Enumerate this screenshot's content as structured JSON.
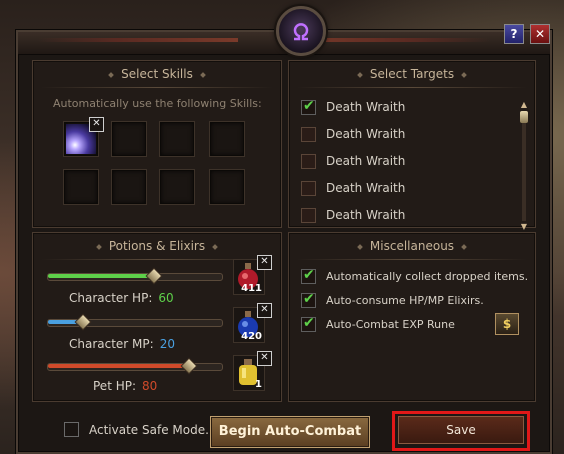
{
  "colors": {
    "check": "#5ed04a",
    "accent_red": "#e01818",
    "hp_green": "#5ed04a",
    "mp_blue": "#4aa0e0",
    "pet_red": "#d04a2a"
  },
  "titlebar": {
    "help_label": "?",
    "close_label": "✕",
    "emblem_icon": "omega-emblem-icon"
  },
  "skills": {
    "title": "Select Skills",
    "subtitle": "Automatically use the following Skills:",
    "remove_label": "✕"
  },
  "targets": {
    "title": "Select Targets",
    "items": [
      {
        "label": "Death Wraith",
        "checked": true
      },
      {
        "label": "Death Wraith",
        "checked": false
      },
      {
        "label": "Death Wraith",
        "checked": false
      },
      {
        "label": "Death Wraith",
        "checked": false
      },
      {
        "label": "Death Wraith",
        "checked": false
      }
    ]
  },
  "potions": {
    "title": "Potions & Elixirs",
    "character_hp": {
      "label": "Character HP:",
      "value": "60",
      "level": 0.6
    },
    "character_mp": {
      "label": "Character MP:",
      "value": "20",
      "level": 0.2
    },
    "pet_hp": {
      "label": "Pet HP:",
      "value": "80",
      "level": 0.8
    },
    "hp_potion_count": "411",
    "mp_potion_count": "420",
    "pet_potion_count": "1",
    "remove_label": "✕"
  },
  "misc": {
    "title": "Miscellaneous",
    "items": [
      {
        "label": "Automatically collect dropped items.",
        "checked": true
      },
      {
        "label": "Auto-consume HP/MP Elixirs.",
        "checked": true
      },
      {
        "label": "Auto-Combat EXP Rune",
        "checked": true
      }
    ],
    "coin_label": "$"
  },
  "bottom": {
    "safe_mode_label": "Activate Safe Mode.",
    "begin_label": "Begin Auto-Combat",
    "save_label": "Save"
  }
}
